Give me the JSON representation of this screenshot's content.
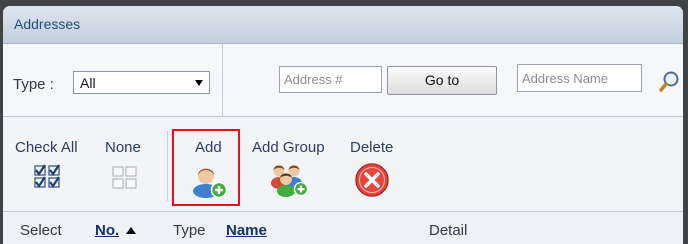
{
  "panel": {
    "title": "Addresses"
  },
  "filters": {
    "type_label": "Type :",
    "type_value": "All",
    "address_number_placeholder": "Address #",
    "goto_label": "Go to",
    "address_name_placeholder": "Address Name"
  },
  "toolbar": {
    "check_all": "Check All",
    "none": "None",
    "add": "Add",
    "add_group": "Add Group",
    "delete": "Delete"
  },
  "columns": {
    "select": "Select",
    "number": "No.",
    "type": "Type",
    "name": "Name",
    "detail": "Detail"
  },
  "colors": {
    "highlight": "#e0141e",
    "delete": "#e2473e",
    "add_badge": "#3fae3f"
  },
  "icons": {
    "search": "magnifier-icon",
    "check_all": "checkboxes-checked-icon",
    "none": "checkboxes-empty-icon",
    "add": "add-user-icon",
    "add_group": "add-group-icon",
    "delete": "delete-x-icon",
    "sort": "sort-ascending-icon"
  }
}
